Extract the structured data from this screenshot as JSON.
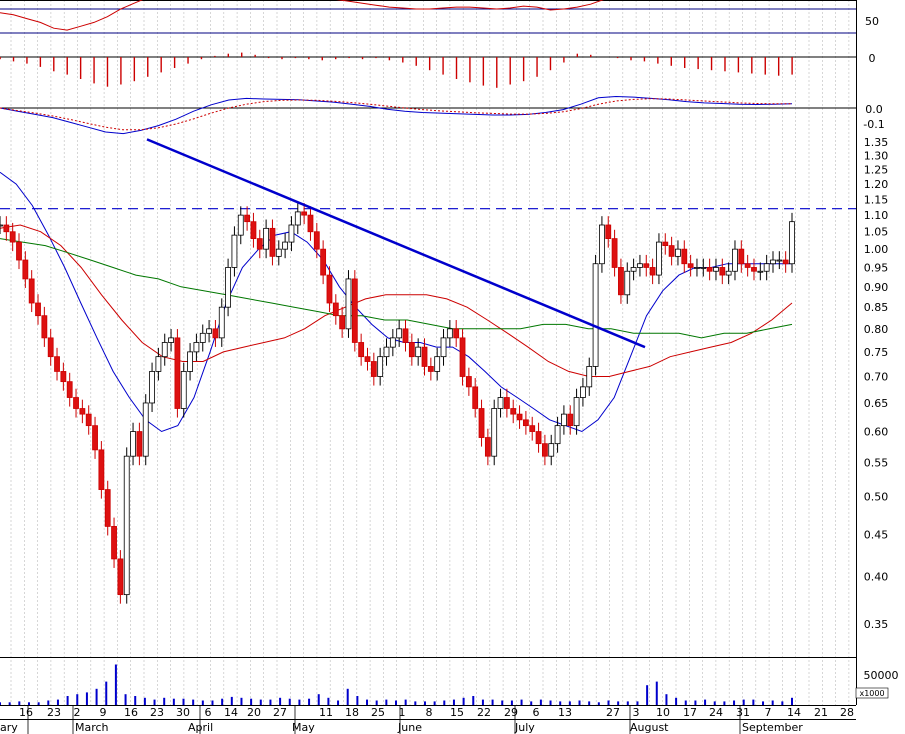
{
  "chart_data": [
    {
      "panel": "oscillator",
      "type": "line",
      "y_tick_labels": [
        "50",
        "0"
      ],
      "series": [
        {
          "color": "#cc0000",
          "values": [
            46,
            44,
            40,
            36,
            30,
            28,
            32,
            36,
            42,
            50,
            56,
            62,
            66,
            70,
            74,
            72,
            71,
            70,
            69,
            68,
            68,
            67,
            66,
            64,
            62,
            60,
            58,
            56,
            54,
            52,
            51,
            50,
            50,
            51,
            52,
            52,
            51,
            50,
            51,
            53,
            52,
            49,
            50,
            52,
            55,
            60,
            70,
            71,
            70,
            69,
            69,
            68,
            68,
            67,
            66,
            66,
            67,
            68,
            70,
            72
          ]
        }
      ]
    },
    {
      "panel": "histogram",
      "type": "bar",
      "y_tick_labels": [
        "0"
      ],
      "values": [
        -2,
        -4,
        -6,
        -9,
        -13,
        -16,
        -20,
        -24,
        -27,
        -25,
        -22,
        -18,
        -14,
        -10,
        -6,
        -2,
        1,
        3,
        4,
        2,
        -1,
        -2,
        -1,
        -2,
        -3,
        -2,
        -1,
        -2,
        -1,
        -3,
        -5,
        -8,
        -12,
        -16,
        -20,
        -23,
        -26,
        -28,
        -25,
        -22,
        -18,
        -12,
        -5,
        3,
        2,
        0,
        -1,
        -3,
        -4,
        -6,
        -8,
        -10,
        -11,
        -12,
        -13,
        -14,
        -15,
        -16,
        -17,
        -16
      ]
    },
    {
      "panel": "macd",
      "type": "line",
      "y_tick_labels": [
        "0.0",
        "-0.1"
      ],
      "series": [
        {
          "color": "#0000cc",
          "values": [
            0.0,
            -0.01,
            -0.02,
            -0.03,
            -0.045,
            -0.06,
            -0.075,
            -0.08,
            -0.07,
            -0.055,
            -0.035,
            -0.01,
            0.01,
            0.025,
            0.03,
            0.028,
            0.027,
            0.026,
            0.022,
            0.018,
            0.012,
            0.005,
            -0.004,
            -0.01,
            -0.014,
            -0.016,
            -0.018,
            -0.02,
            -0.022,
            -0.022,
            -0.02,
            -0.014,
            -0.005,
            0.012,
            0.032,
            0.036,
            0.034,
            0.03,
            0.026,
            0.02,
            0.016,
            0.014,
            0.012,
            0.011,
            0.012,
            0.013
          ]
        },
        {
          "color": "#cc0000",
          "dashed": true,
          "values": [
            0.0,
            -0.008,
            -0.016,
            -0.025,
            -0.036,
            -0.048,
            -0.06,
            -0.068,
            -0.068,
            -0.062,
            -0.05,
            -0.034,
            -0.016,
            0.0,
            0.012,
            0.02,
            0.024,
            0.025,
            0.024,
            0.021,
            0.017,
            0.012,
            0.006,
            0.0,
            -0.005,
            -0.009,
            -0.012,
            -0.015,
            -0.017,
            -0.019,
            -0.019,
            -0.017,
            -0.012,
            -0.002,
            0.012,
            0.022,
            0.027,
            0.029,
            0.028,
            0.025,
            0.022,
            0.019,
            0.016,
            0.014,
            0.013,
            0.013
          ]
        }
      ]
    },
    {
      "panel": "price",
      "type": "line",
      "log_scale": true,
      "ylim": [
        0.32,
        1.36
      ],
      "y_tick_labels": [
        "1.35",
        "1.30",
        "1.25",
        "1.20",
        "1.15",
        "1.10",
        "1.05",
        "1.00",
        "0.95",
        "0.90",
        "0.85",
        "0.80",
        "0.75",
        "0.70",
        "0.65",
        "0.60",
        "0.55",
        "0.50",
        "0.45",
        "0.40",
        "0.35"
      ],
      "y_tick_values": [
        1.35,
        1.3,
        1.25,
        1.2,
        1.15,
        1.1,
        1.05,
        1.0,
        0.95,
        0.9,
        0.85,
        0.8,
        0.75,
        0.7,
        0.65,
        0.6,
        0.55,
        0.5,
        0.45,
        0.4,
        0.35
      ],
      "resistance_level": 1.12,
      "trendline": {
        "from": [
          0.147,
          1.36
        ],
        "to": [
          0.645,
          0.76
        ]
      },
      "close_values": [
        1.07,
        1.05,
        1.02,
        0.97,
        0.92,
        0.86,
        0.83,
        0.78,
        0.74,
        0.71,
        0.69,
        0.66,
        0.64,
        0.63,
        0.61,
        0.57,
        0.51,
        0.46,
        0.42,
        0.38,
        0.56,
        0.6,
        0.56,
        0.65,
        0.71,
        0.74,
        0.77,
        0.78,
        0.64,
        0.71,
        0.75,
        0.77,
        0.79,
        0.8,
        0.78,
        0.85,
        0.95,
        1.04,
        1.1,
        1.08,
        1.03,
        1.0,
        1.06,
        0.98,
        1.0,
        1.02,
        1.07,
        1.11,
        1.1,
        1.05,
        1.0,
        0.93,
        0.86,
        0.83,
        0.8,
        0.92,
        0.77,
        0.74,
        0.73,
        0.7,
        0.74,
        0.76,
        0.78,
        0.8,
        0.77,
        0.74,
        0.76,
        0.72,
        0.71,
        0.74,
        0.78,
        0.8,
        0.78,
        0.7,
        0.68,
        0.64,
        0.59,
        0.56,
        0.64,
        0.66,
        0.64,
        0.63,
        0.62,
        0.61,
        0.6,
        0.58,
        0.56,
        0.58,
        0.61,
        0.63,
        0.61,
        0.66,
        0.68,
        0.72,
        0.96,
        1.07,
        1.03,
        0.95,
        0.88,
        0.94,
        0.95,
        0.96,
        0.95,
        0.93,
        1.02,
        1.01,
        0.98,
        1.0,
        0.96,
        0.95,
        0.95,
        0.95,
        0.94,
        0.95,
        0.93,
        0.94,
        1.0,
        0.96,
        0.95,
        0.94,
        0.94,
        0.96,
        0.97,
        0.97,
        0.96,
        1.08
      ],
      "series": [
        {
          "color": "#0000cc",
          "values": [
            1.24,
            1.2,
            1.13,
            1.04,
            0.95,
            0.86,
            0.78,
            0.71,
            0.66,
            0.62,
            0.6,
            0.61,
            0.66,
            0.75,
            0.86,
            0.95,
            1.0,
            1.04,
            1.05,
            1.02,
            0.97,
            0.9,
            0.85,
            0.81,
            0.78,
            0.77,
            0.77,
            0.76,
            0.76,
            0.74,
            0.71,
            0.68,
            0.66,
            0.64,
            0.62,
            0.61,
            0.6,
            0.62,
            0.66,
            0.74,
            0.83,
            0.89,
            0.93,
            0.95,
            0.95,
            0.96,
            0.96,
            0.96,
            0.96,
            0.96
          ]
        },
        {
          "color": "#cc0000",
          "values": [
            1.06,
            1.07,
            1.05,
            1.01,
            0.95,
            0.88,
            0.82,
            0.77,
            0.74,
            0.73,
            0.73,
            0.75,
            0.76,
            0.77,
            0.78,
            0.8,
            0.83,
            0.85,
            0.87,
            0.88,
            0.88,
            0.88,
            0.87,
            0.85,
            0.82,
            0.79,
            0.76,
            0.73,
            0.71,
            0.7,
            0.7,
            0.71,
            0.72,
            0.74,
            0.75,
            0.76,
            0.77,
            0.79,
            0.82,
            0.86
          ]
        },
        {
          "color": "#007700",
          "values": [
            1.03,
            1.02,
            1.01,
            0.99,
            0.97,
            0.95,
            0.93,
            0.92,
            0.9,
            0.89,
            0.88,
            0.87,
            0.86,
            0.85,
            0.84,
            0.83,
            0.83,
            0.82,
            0.82,
            0.81,
            0.8,
            0.8,
            0.8,
            0.8,
            0.81,
            0.81,
            0.8,
            0.8,
            0.79,
            0.79,
            0.79,
            0.78,
            0.79,
            0.79,
            0.8,
            0.81
          ]
        }
      ]
    },
    {
      "panel": "volume",
      "type": "bar",
      "y_tick_labels": [
        "50000"
      ],
      "unit_label": "x1000",
      "values": [
        3,
        3,
        4,
        3,
        3,
        5,
        6,
        10,
        12,
        14,
        18,
        26,
        45,
        12,
        10,
        8,
        6,
        8,
        7,
        7,
        6,
        5,
        5,
        7,
        9,
        8,
        7,
        6,
        6,
        8,
        7,
        6,
        7,
        12,
        8,
        5,
        18,
        10,
        6,
        5,
        6,
        5,
        6,
        4,
        4,
        4,
        5,
        6,
        8,
        10,
        6,
        6,
        5,
        5,
        6,
        4,
        6,
        5,
        4,
        4,
        5,
        4,
        3,
        5,
        4,
        4,
        4,
        22,
        26,
        12,
        8,
        5,
        5,
        6,
        4,
        4,
        5,
        6,
        6,
        4,
        5,
        4,
        8
      ]
    }
  ],
  "x_axis": {
    "day_labels": [
      "16",
      "23",
      "2",
      "9",
      "16",
      "23",
      "30",
      "6",
      "14",
      "20",
      "27",
      "11",
      "18",
      "25",
      "1",
      "8",
      "15",
      "22",
      "29",
      "6",
      "13",
      "27",
      "3",
      "10",
      "17",
      "24",
      "31",
      "7",
      "14",
      "21",
      "28"
    ],
    "month_labels": [
      "ary",
      "March",
      "April",
      "May",
      "June",
      "July",
      "August",
      "September"
    ]
  }
}
